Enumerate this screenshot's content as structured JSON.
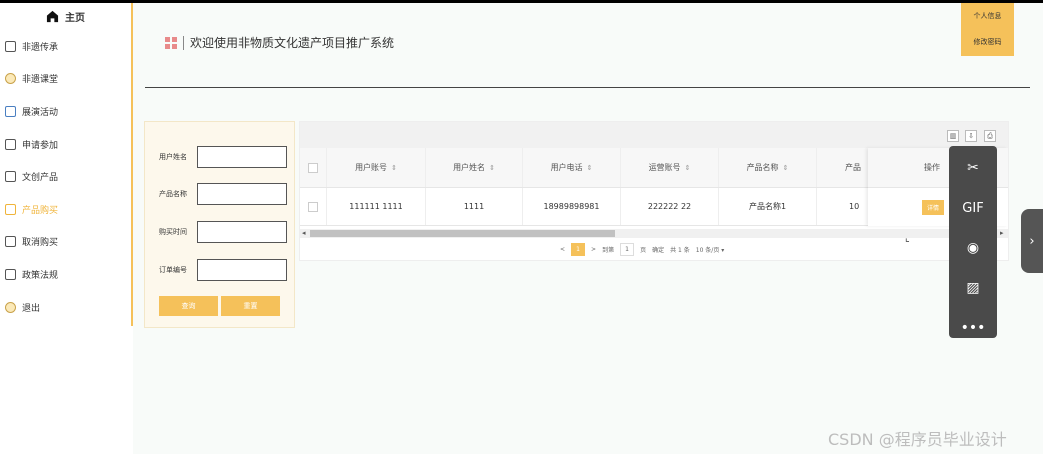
{
  "sidebar": {
    "home": "主页",
    "items": [
      {
        "label": "非遗传承",
        "icon": "bookmark-icon"
      },
      {
        "label": "非遗课堂",
        "icon": "coin-icon"
      },
      {
        "label": "展演活动",
        "icon": "calendar-icon"
      },
      {
        "label": "申请参加",
        "icon": "folder-icon"
      },
      {
        "label": "文创产品",
        "icon": "folder-icon"
      },
      {
        "label": "产品购买",
        "icon": "inbox-icon",
        "active": true
      },
      {
        "label": "取消购买",
        "icon": "bookmark-icon"
      },
      {
        "label": "政策法规",
        "icon": "inbox-icon"
      },
      {
        "label": "退出",
        "icon": "coin-icon"
      }
    ]
  },
  "header": {
    "title": "欢迎使用非物质文化遗产项目推广系统",
    "user_info": "个人信息",
    "change_password": "修改密码"
  },
  "search": {
    "fields": [
      {
        "label": "用户姓名",
        "value": ""
      },
      {
        "label": "产品名称",
        "value": ""
      },
      {
        "label": "购买时间",
        "value": ""
      },
      {
        "label": "订单编号",
        "value": ""
      }
    ],
    "query_btn": "查询",
    "reset_btn": "重置"
  },
  "table": {
    "toolbar": [
      "filter-icon",
      "export-icon",
      "print-icon"
    ],
    "columns": [
      "用户账号",
      "用户姓名",
      "用户电话",
      "运营账号",
      "产品名称",
      "产品"
    ],
    "rows": [
      {
        "cells": [
          "111111 1111",
          "1111",
          "18989898981",
          "222222 22",
          "产品名称1",
          "10"
        ]
      }
    ],
    "op_header": "操作",
    "op_button": "详情"
  },
  "pager": {
    "prev": "<",
    "current": "1",
    "next": ">",
    "goto_label": "到第",
    "goto_value": "1",
    "page_unit": "页",
    "confirm": "确定",
    "total": "共 1 条",
    "page_size": "10 条/页"
  },
  "float_bar": {
    "items": [
      "scissors-icon",
      "GIF",
      "record-icon",
      "image-icon",
      "more-icon"
    ],
    "gif": "GIF"
  },
  "watermark": "CSDN @程序员毕业设计"
}
